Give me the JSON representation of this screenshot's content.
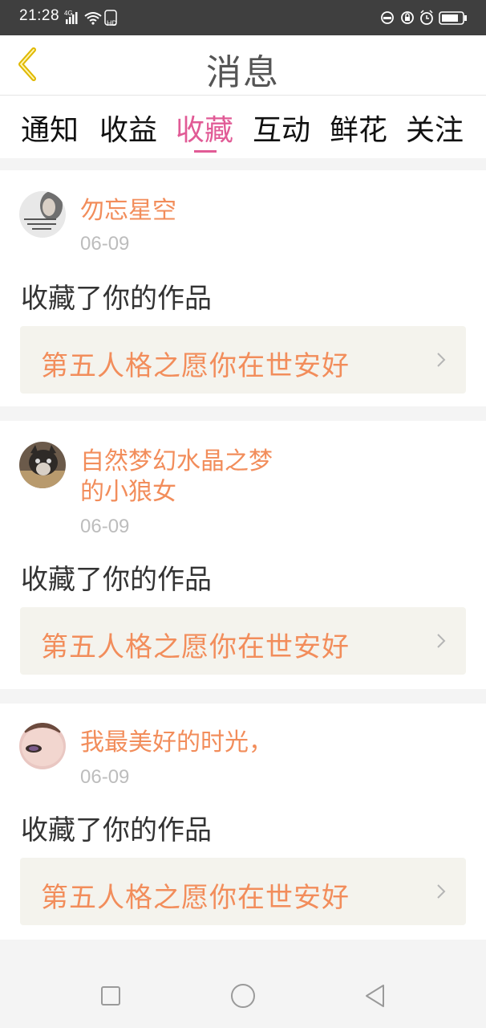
{
  "status_bar": {
    "time": "21:28",
    "network": "4G",
    "hd": "HD",
    "icons": [
      "signal-icon",
      "wifi-icon",
      "hd-icon",
      "data-saver-icon",
      "lock-icon",
      "alarm-icon",
      "battery-icon"
    ]
  },
  "header": {
    "title": "消息",
    "back_icon": "chevron-left-icon",
    "back_color": "#e0b800"
  },
  "tabs": [
    {
      "label": "通知",
      "active": false
    },
    {
      "label": "收益",
      "active": false
    },
    {
      "label": "收藏",
      "active": true
    },
    {
      "label": "互动",
      "active": false
    },
    {
      "label": "鲜花",
      "active": false
    },
    {
      "label": "关注",
      "active": false
    }
  ],
  "messages": [
    {
      "user": "勿忘星空",
      "date": "06-09",
      "action": "收藏了你的作品",
      "work_title": "第五人格之愿你在世安好"
    },
    {
      "user_line1": "自然梦幻水晶之梦",
      "user_line2": "的小狼女",
      "date": "06-09",
      "action": "收藏了你的作品",
      "work_title": "第五人格之愿你在世安好"
    },
    {
      "user": "我最美好的时光，",
      "date": "06-09",
      "action": "收藏了你的作品",
      "work_title": "第五人格之愿你在世安好"
    }
  ],
  "colors": {
    "accent_pink": "#e15b96",
    "name_orange": "#f28d5b",
    "work_bg": "#f4f3ed"
  },
  "nav_bar": {
    "icons": [
      "recent-apps-icon",
      "home-icon",
      "back-triangle-icon"
    ]
  }
}
